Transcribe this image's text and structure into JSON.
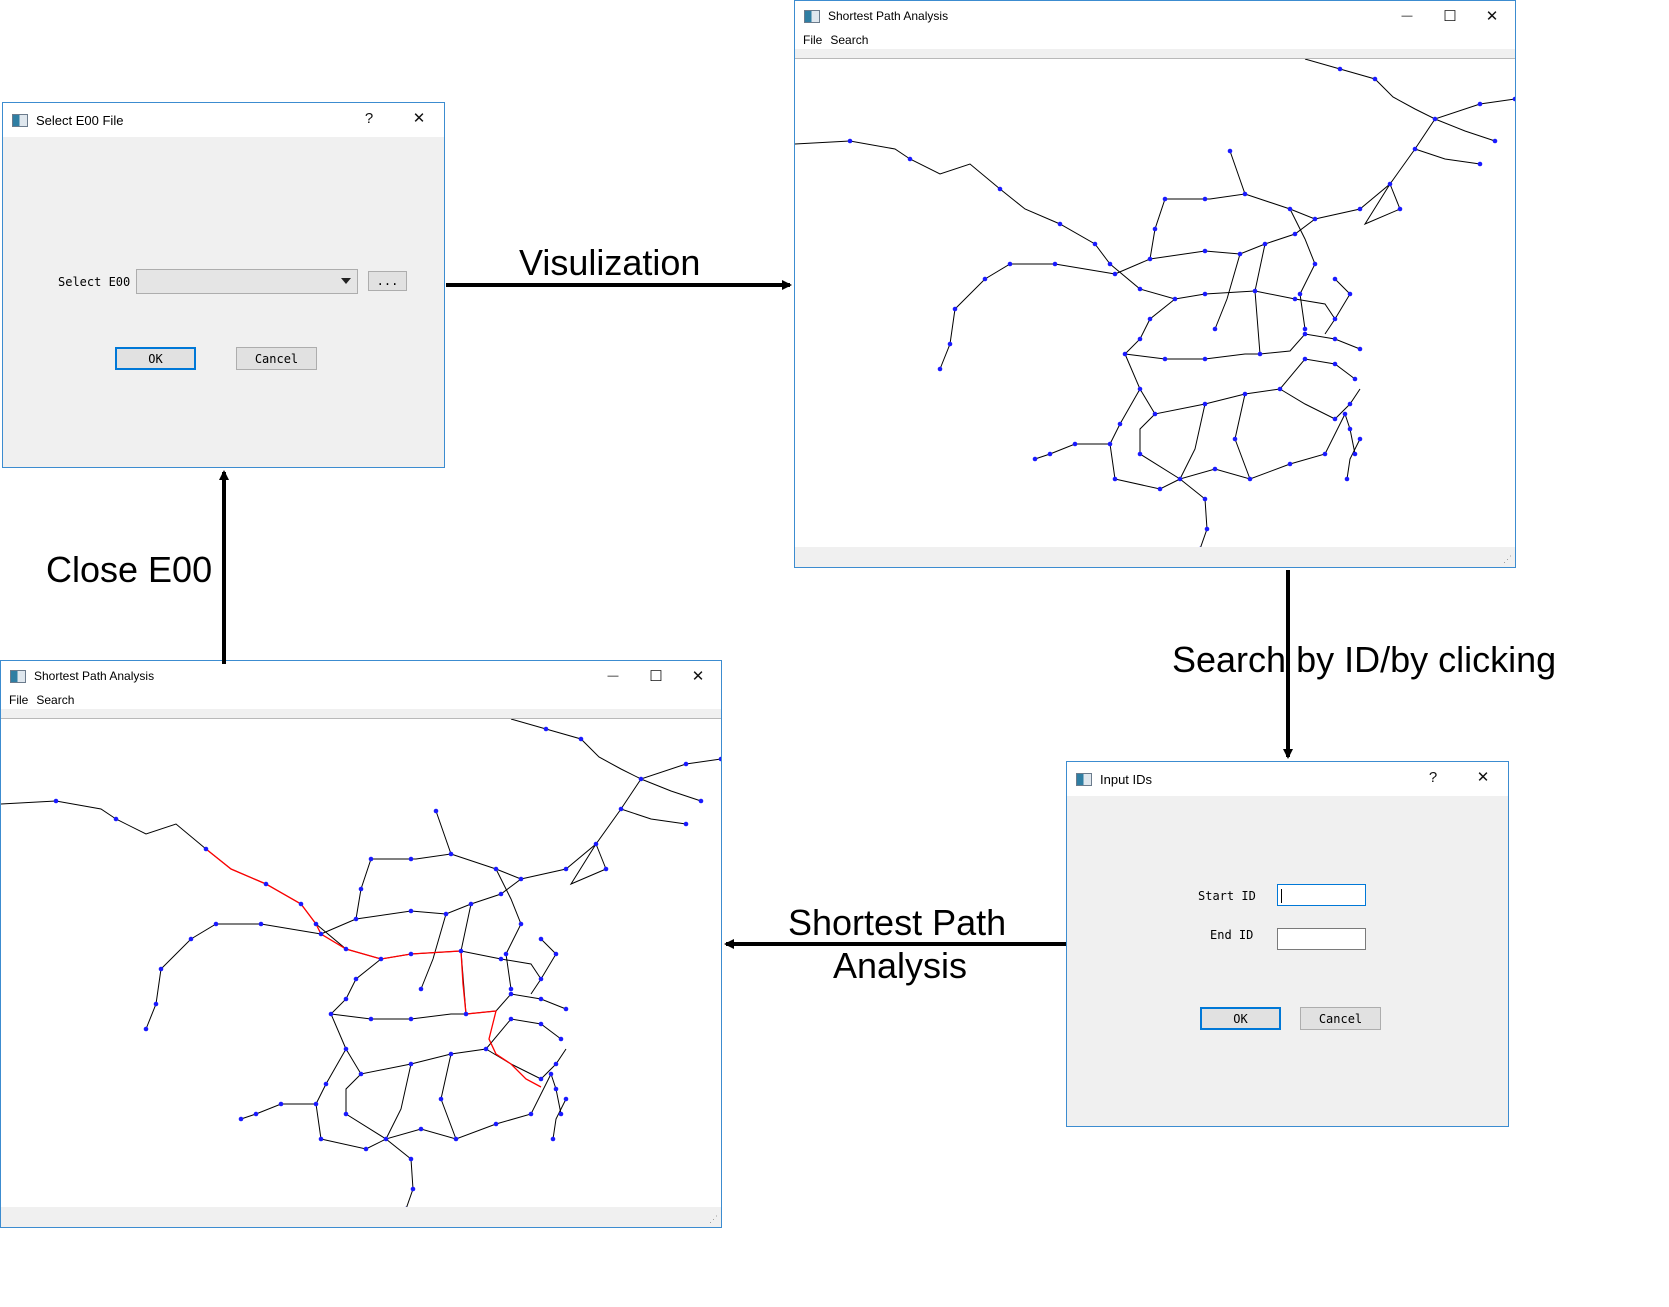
{
  "select_dialog": {
    "title": "Select E00 File",
    "help_label": "?",
    "close_label": "✕",
    "field_label": "Select E00",
    "browse_label": "...",
    "ok_label": "OK",
    "cancel_label": "Cancel"
  },
  "map_window": {
    "title": "Shortest Path Analysis",
    "minimize_label": "—",
    "maximize_label": "☐",
    "close_label": "✕",
    "menus": [
      "File",
      "Search"
    ]
  },
  "input_dialog": {
    "title": "Input IDs",
    "help_label": "?",
    "close_label": "✕",
    "start_label": "Start ID",
    "end_label": "End ID",
    "ok_label": "OK",
    "cancel_label": "Cancel"
  },
  "result_window": {
    "title": "Shortest Path Analysis",
    "minimize_label": "—",
    "maximize_label": "☐",
    "close_label": "✕",
    "menus": [
      "File",
      "Search"
    ]
  },
  "flow": {
    "visualization": "Visulization",
    "search": "Search by ID/by clicking",
    "shortest_line1": "Shortest Path",
    "shortest_line2": "Analysis",
    "close": "Close E00"
  },
  "colors": {
    "border": "#3c8cd0",
    "road": "#000000",
    "node": "#1a1aff",
    "path": "#ff0000"
  }
}
